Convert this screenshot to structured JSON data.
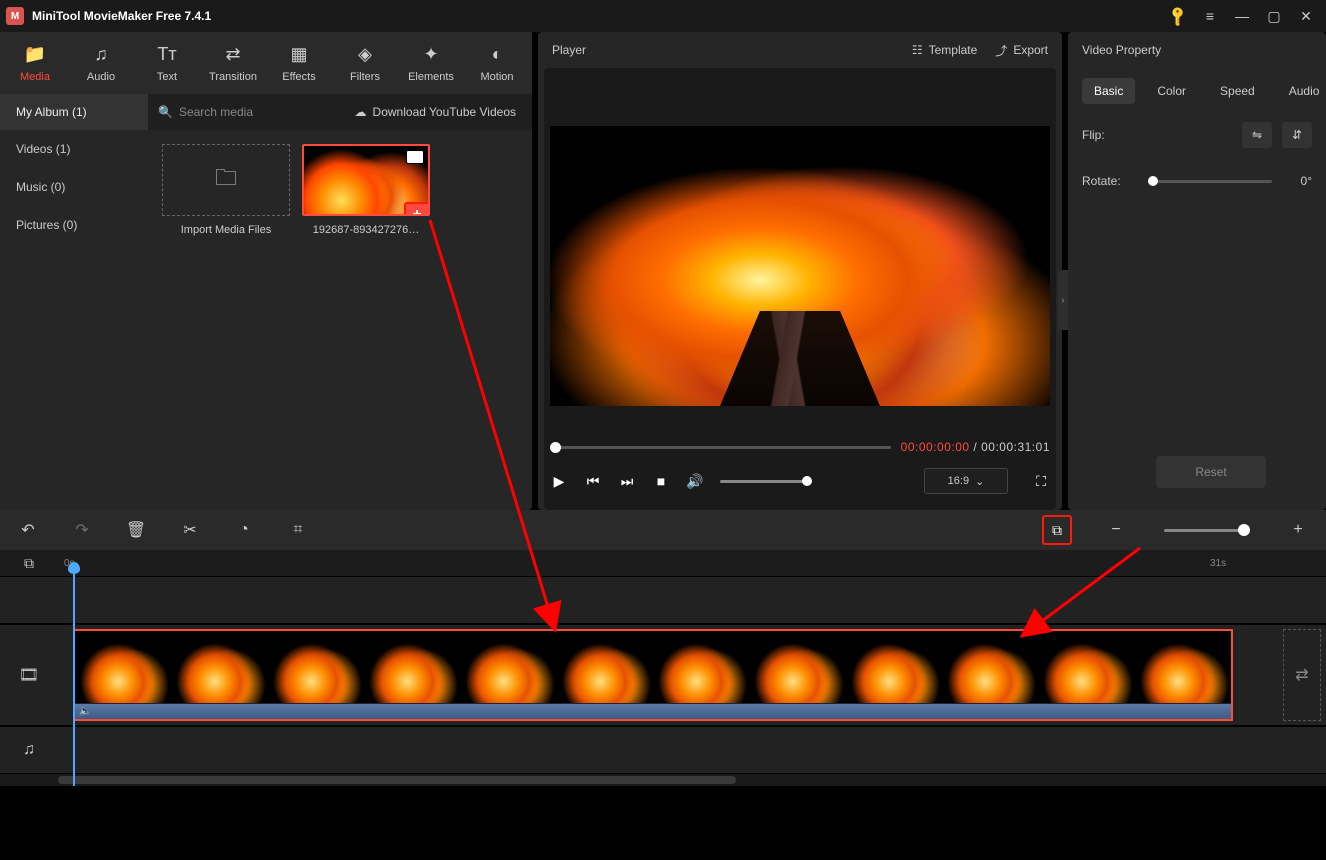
{
  "app": {
    "title": "MiniTool MovieMaker Free 7.4.1"
  },
  "tabs": {
    "media": "Media",
    "audio": "Audio",
    "text": "Text",
    "transition": "Transition",
    "effects": "Effects",
    "filters": "Filters",
    "elements": "Elements",
    "motion": "Motion"
  },
  "media": {
    "album_head": "My Album (1)",
    "search_placeholder": "Search media",
    "youtube": "Download YouTube Videos",
    "sidebar": {
      "videos": "Videos (1)",
      "music": "Music (0)",
      "pictures": "Pictures (0)"
    },
    "import_label": "Import Media Files",
    "clip_name": "192687-893427276…"
  },
  "player": {
    "title": "Player",
    "template": "Template",
    "export": "Export",
    "time_current": "00:00:00:00",
    "time_sep": " / ",
    "time_total": "00:00:31:01",
    "ratio": "16:9"
  },
  "property": {
    "title": "Video Property",
    "tabs": {
      "basic": "Basic",
      "color": "Color",
      "speed": "Speed",
      "audio": "Audio"
    },
    "flip": "Flip:",
    "rotate": "Rotate:",
    "rotate_val": "0°",
    "reset": "Reset"
  },
  "timeline": {
    "ruler_start": "0s",
    "ruler_end": "31s"
  }
}
